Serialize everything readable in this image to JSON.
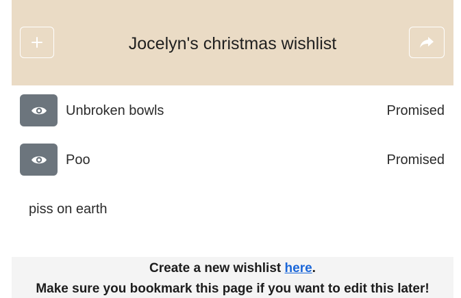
{
  "header": {
    "title": "Jocelyn's christmas wishlist",
    "add_icon": "plus-icon",
    "share_icon": "share-arrow-icon",
    "background": "#eadbc5"
  },
  "items": [
    {
      "name": "Unbroken bowls",
      "status": "Promised",
      "icon": "eye-icon"
    },
    {
      "name": "Poo",
      "status": "Promised",
      "icon": "eye-icon"
    }
  ],
  "note": "piss on earth",
  "footer": {
    "line1_prefix": "Create a new wishlist ",
    "line1_link": "here",
    "line1_suffix": ".",
    "line2": "Make sure you bookmark this page if you want to edit this later!",
    "link_color": "#1a66d9"
  },
  "colors": {
    "eye_button": "#6c757d",
    "footer_bg": "#f4f4f4"
  }
}
